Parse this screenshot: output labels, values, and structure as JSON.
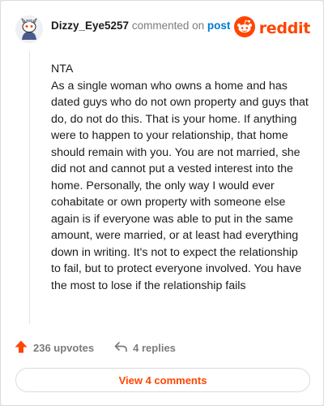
{
  "header": {
    "username": "Dizzy_Eye5257",
    "commented_text": "commented on",
    "post_link": "post",
    "brand": "reddit",
    "avatar_icon": "snoo-avatar-icon",
    "brand_icon": "reddit-alien-icon"
  },
  "comment": {
    "verdict": "NTA",
    "text": "As a single woman who owns a home and has dated guys who do not own property and guys that do, do not do this. That is your home. If anything were to happen to your relationship, that home should remain with you. You are not married, she did not and cannot put a vested interest into the home. Personally, the only way I would ever cohabitate or own property with someone else again is if everyone was able to put in the same amount, were married, or at least had everything down in writing. It's not to expect the relationship to fail, but to protect everyone involved. You have the most to lose if the relationship fails"
  },
  "actions": {
    "upvotes": "236 upvotes",
    "replies": "4 replies",
    "upvote_icon": "upvote-arrow-icon",
    "reply_icon": "reply-arrow-icon"
  },
  "view_comments": "View 4 comments",
  "colors": {
    "accent": "#ff4500",
    "link": "#0079d3",
    "muted": "#7c7c7c"
  }
}
